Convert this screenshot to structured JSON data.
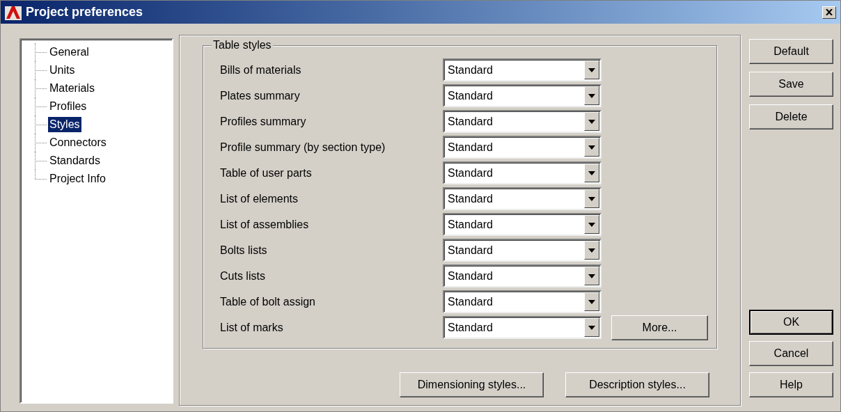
{
  "window": {
    "title": "Project preferences"
  },
  "tree": {
    "items": [
      {
        "label": "General",
        "selected": false
      },
      {
        "label": "Units",
        "selected": false
      },
      {
        "label": "Materials",
        "selected": false
      },
      {
        "label": "Profiles",
        "selected": false
      },
      {
        "label": "Styles",
        "selected": true
      },
      {
        "label": "Connectors",
        "selected": false
      },
      {
        "label": "Standards",
        "selected": false
      },
      {
        "label": "Project Info",
        "selected": false
      }
    ]
  },
  "table_styles": {
    "title": "Table styles",
    "rows": [
      {
        "label": "Bills of materials",
        "value": "Standard"
      },
      {
        "label": "Plates summary",
        "value": "Standard"
      },
      {
        "label": "Profiles summary",
        "value": "Standard"
      },
      {
        "label": "Profile summary (by section type)",
        "value": "Standard"
      },
      {
        "label": "Table of user parts",
        "value": "Standard"
      },
      {
        "label": "List of elements",
        "value": "Standard"
      },
      {
        "label": "List of assemblies",
        "value": "Standard"
      },
      {
        "label": "Bolts lists",
        "value": "Standard"
      },
      {
        "label": "Cuts lists",
        "value": "Standard"
      },
      {
        "label": "Table of bolt assign",
        "value": "Standard"
      },
      {
        "label": "List of marks",
        "value": "Standard"
      }
    ],
    "more_button": "More..."
  },
  "bottom_buttons": [
    "Dimensioning styles...",
    "Description styles..."
  ],
  "side_buttons_top": [
    {
      "label": "Default",
      "default": false
    },
    {
      "label": "Save",
      "default": false
    },
    {
      "label": "Delete",
      "default": false
    }
  ],
  "side_buttons_bottom": [
    {
      "label": "OK",
      "default": true
    },
    {
      "label": "Cancel",
      "default": false
    },
    {
      "label": "Help",
      "default": false
    }
  ]
}
